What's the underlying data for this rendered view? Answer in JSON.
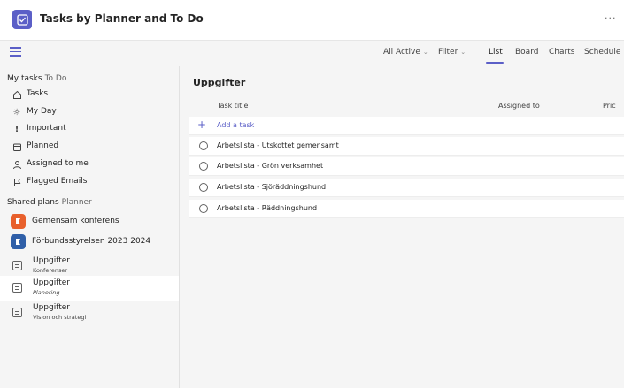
{
  "app": {
    "title": "Tasks by Planner and To Do",
    "more": "···"
  },
  "toolbar": {
    "all_active": "All Active",
    "filter": "Filter",
    "tabs": [
      "List",
      "Board",
      "Charts",
      "Schedule"
    ],
    "active_tab": "List"
  },
  "sidebar": {
    "my_tasks": "My tasks",
    "my_tasks_sub": "To Do",
    "items": [
      {
        "label": "Tasks",
        "icon": "home-icon"
      },
      {
        "label": "My Day",
        "icon": "sun-icon"
      },
      {
        "label": "Important",
        "icon": "exclamation-icon"
      },
      {
        "label": "Planned",
        "icon": "calendar-icon"
      },
      {
        "label": "Assigned to me",
        "icon": "person-icon"
      },
      {
        "label": "Flagged Emails",
        "icon": "flag-icon"
      }
    ],
    "shared_plans": "Shared plans",
    "shared_plans_sub": "Planner",
    "plans": [
      {
        "label": "Gemensam konferens",
        "color": "#e8602c"
      },
      {
        "label": "Förbundsstyrelsen 2023 2024",
        "color": "#2f5fa8"
      }
    ],
    "buckets": [
      {
        "title": "Uppgifter",
        "subtitle": "Konferenser"
      },
      {
        "title": "Uppgifter",
        "subtitle": "Planering"
      },
      {
        "title": "Uppgifter",
        "subtitle": "Vision och strategi"
      }
    ]
  },
  "main": {
    "title": "Uppgifter",
    "columns": {
      "title": "Task title",
      "assigned": "Assigned to",
      "priority": "Pric"
    },
    "add_task": "Add a task",
    "tasks": [
      "Arbetslista - Utskottet gemensamt",
      "Arbetslista - Grön verksamhet",
      "Arbetslista - Sjöräddningshund",
      "Arbetslista - Räddningshund"
    ]
  },
  "colors": {
    "accent": "#5b5fc7",
    "background": "#f5f5f5"
  }
}
